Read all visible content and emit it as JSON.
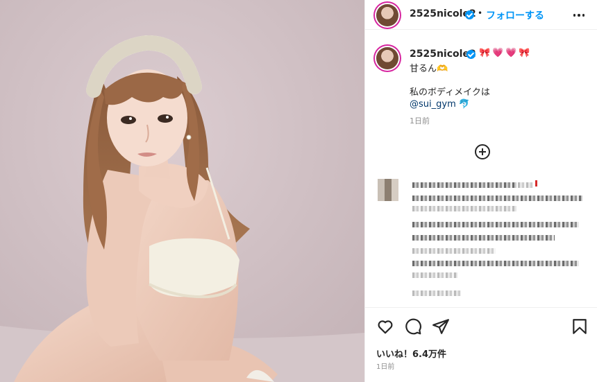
{
  "post": {
    "username": "2525nicole2",
    "follow_label": "フォローする",
    "separator": "•",
    "caption": {
      "emojis": [
        "🎀",
        "💗",
        "💗",
        "🎀"
      ],
      "line1": "甘るん",
      "line1_emoji": "🫶",
      "line2": "私のボディメイクは",
      "mention": "@sui_gym",
      "mention_emoji": "🐬",
      "timestamp": "1日前"
    },
    "likes_label": "いいね！6.4万件",
    "timestamp": "1日前"
  },
  "icons": {
    "more": "more-options-icon",
    "verified": "verified-badge-icon",
    "add_comment": "add-circle-icon",
    "like": "heart-icon",
    "comment": "comment-icon",
    "share": "send-icon",
    "save": "bookmark-icon"
  },
  "colors": {
    "accent": "#0095f6",
    "text": "#262626",
    "muted": "#8e8e8e",
    "border": "#efefef",
    "mention": "#00376b",
    "story_ring": "#d6249f"
  }
}
